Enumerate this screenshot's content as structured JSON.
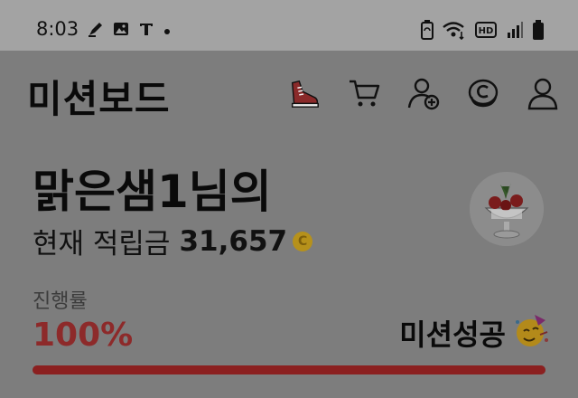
{
  "status_bar": {
    "time": "8:03",
    "left_icons": [
      "pen-icon",
      "image-icon",
      "text-icon",
      "dot-icon"
    ],
    "right_icons": [
      "battery-saver-icon",
      "wifi-icon",
      "hd-icon",
      "signal-icon",
      "battery-icon"
    ],
    "hd_label": "HD"
  },
  "header": {
    "title": "미션보드",
    "icons": [
      "sneaker-icon",
      "cart-icon",
      "add-user-icon",
      "coin-icon",
      "profile-icon"
    ]
  },
  "greeting": {
    "name_line": "맑은샘1님의",
    "points_label": "현재 적립금",
    "points_value": "31,657",
    "coin_symbol": "C"
  },
  "progress": {
    "label": "진행률",
    "value_text": "100%",
    "fraction": 1.0,
    "status": "미션성공",
    "status_emoji": "🥳"
  },
  "colors": {
    "accent": "#8b2020",
    "coin": "#b6911b"
  }
}
